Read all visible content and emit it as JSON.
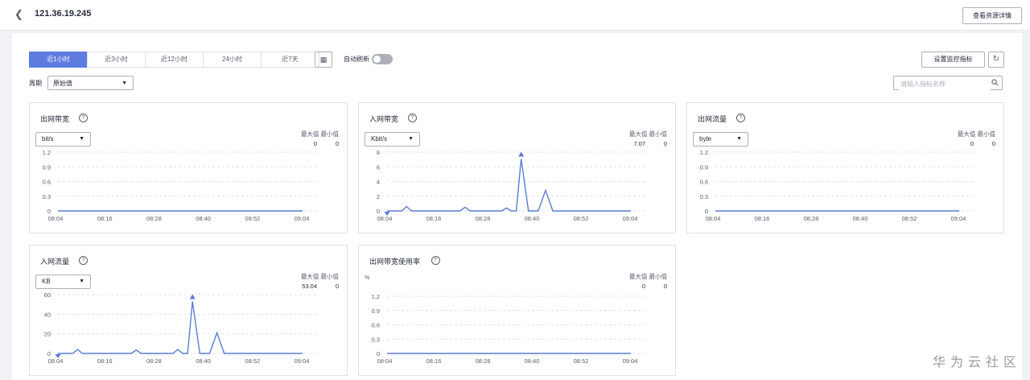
{
  "header": {
    "back_icon": "chevron-left-icon",
    "title": "121.36.19.245",
    "detail_button": "查看资源详情"
  },
  "toolbar": {
    "tabs": [
      {
        "label": "近1小时",
        "active": true
      },
      {
        "label": "近3小时",
        "active": false
      },
      {
        "label": "近12小时",
        "active": false
      },
      {
        "label": "24小时",
        "active": false
      },
      {
        "label": "近7天",
        "active": false
      }
    ],
    "calendar_icon": "calendar-icon",
    "auto_refresh_label": "自动刷新",
    "auto_refresh_on": false,
    "set_metrics_button": "设置监控指标",
    "refresh_icon": "refresh-icon"
  },
  "filter": {
    "period_label": "周期",
    "period_value": "原始值",
    "search_placeholder": "请输入指标名称",
    "search_value": ""
  },
  "stats_header": "最大值 最小值",
  "cards": [
    {
      "title": "出网带宽",
      "unit": "bit/s",
      "max": "0",
      "min": "0"
    },
    {
      "title": "入网带宽",
      "unit": "Kbit/s",
      "max": "7.07",
      "min": "0"
    },
    {
      "title": "出网流量",
      "unit": "byte",
      "max": "0",
      "min": "0"
    },
    {
      "title": "入网流量",
      "unit": "KB",
      "max": "53.04",
      "min": "0"
    },
    {
      "title": "出网带宽使用率",
      "unit": "%",
      "max": "0",
      "min": "0"
    }
  ],
  "chart_data": [
    {
      "type": "line",
      "title": "出网带宽",
      "x_ticks": [
        "08:04",
        "08:16",
        "08:28",
        "08:40",
        "08:52",
        "09:04"
      ],
      "y_ticks": [
        "1.2",
        "0.9",
        "0.6",
        "0.3",
        "0"
      ],
      "ylim": [
        0,
        1.2
      ],
      "points": [
        [
          0,
          0
        ],
        [
          1,
          0
        ]
      ],
      "max_marker": false,
      "min_marker": false
    },
    {
      "type": "line",
      "title": "入网带宽",
      "x_ticks": [
        "08:04",
        "08:16",
        "08:28",
        "08:40",
        "08:52",
        "09:04"
      ],
      "y_ticks": [
        "8",
        "6",
        "4",
        "2",
        "0"
      ],
      "ylim": [
        0,
        8
      ],
      "points": [
        [
          0,
          0
        ],
        [
          0.06,
          0
        ],
        [
          0.08,
          0.6
        ],
        [
          0.1,
          0
        ],
        [
          0.3,
          0
        ],
        [
          0.32,
          0.5
        ],
        [
          0.34,
          0
        ],
        [
          0.47,
          0
        ],
        [
          0.49,
          0.4
        ],
        [
          0.51,
          0
        ],
        [
          0.53,
          0
        ],
        [
          0.55,
          7.07
        ],
        [
          0.58,
          0
        ],
        [
          0.62,
          0
        ],
        [
          0.65,
          2.8
        ],
        [
          0.68,
          0
        ],
        [
          1,
          0
        ]
      ],
      "max_marker": true,
      "min_marker": true
    },
    {
      "type": "line",
      "title": "出网流量",
      "x_ticks": [
        "08:04",
        "08:16",
        "08:28",
        "08:40",
        "08:52",
        "09:04"
      ],
      "y_ticks": [
        "1.2",
        "0.9",
        "0.6",
        "0.3",
        "0"
      ],
      "ylim": [
        0,
        1.2
      ],
      "points": [
        [
          0,
          0
        ],
        [
          1,
          0
        ]
      ],
      "max_marker": false,
      "min_marker": false
    },
    {
      "type": "line",
      "title": "入网流量",
      "x_ticks": [
        "08:04",
        "08:16",
        "08:28",
        "08:40",
        "08:52",
        "09:04"
      ],
      "y_ticks": [
        "60",
        "40",
        "20",
        "0"
      ],
      "ylim": [
        0,
        60
      ],
      "points": [
        [
          0,
          0
        ],
        [
          0.06,
          0
        ],
        [
          0.08,
          4
        ],
        [
          0.1,
          0
        ],
        [
          0.3,
          0
        ],
        [
          0.32,
          3.5
        ],
        [
          0.34,
          0
        ],
        [
          0.47,
          0
        ],
        [
          0.49,
          4
        ],
        [
          0.51,
          0
        ],
        [
          0.53,
          0
        ],
        [
          0.55,
          53.04
        ],
        [
          0.58,
          0
        ],
        [
          0.62,
          0
        ],
        [
          0.65,
          21
        ],
        [
          0.68,
          0
        ],
        [
          1,
          0
        ]
      ],
      "max_marker": true,
      "min_marker": true
    },
    {
      "type": "line",
      "title": "出网带宽使用率",
      "x_ticks": [
        "08:04",
        "08:16",
        "08:28",
        "08:40",
        "08:52",
        "09:04"
      ],
      "y_ticks": [
        "1.2",
        "0.9",
        "0.6",
        "0.3",
        "0"
      ],
      "ylim": [
        0,
        1.2
      ],
      "points": [
        [
          0,
          0
        ],
        [
          1,
          0
        ]
      ],
      "max_marker": false,
      "min_marker": false
    }
  ],
  "colors": {
    "accent": "#5e7ce0",
    "line": "#5b7bd5",
    "grid": "#dfe1e6"
  },
  "watermark": "华为云社区"
}
